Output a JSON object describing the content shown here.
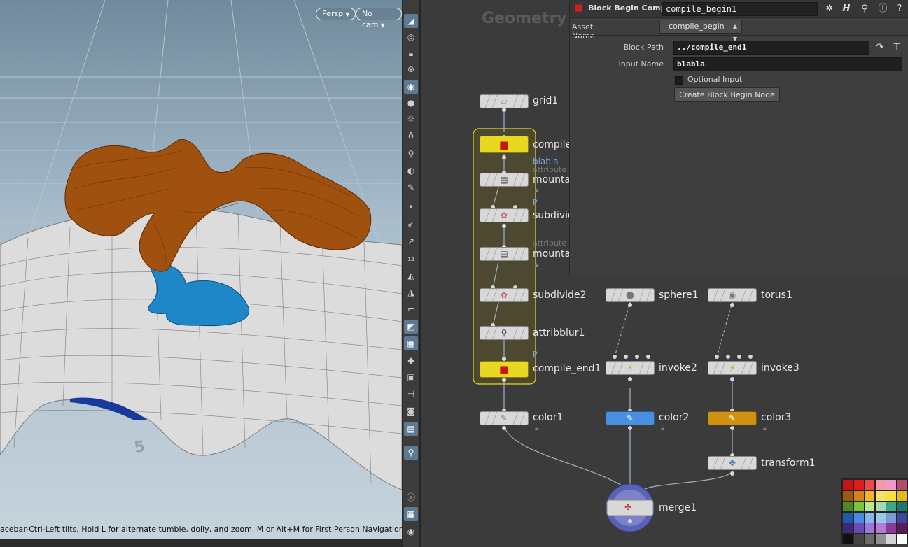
{
  "viewport": {
    "camera_mode": "Persp",
    "camera": "No cam",
    "status_text": "acebar-Ctrl-Left tilts. Hold L for alternate tumble, dolly, and zoom.    M or Alt+M for First Person Navigation.",
    "grid_number": "5"
  },
  "toolbar_icons": [
    "view-icon",
    "ghost-icon",
    "lock-icon",
    "snap-icon",
    "display-icon",
    "light-icon",
    "headlight-icon",
    "shadow-icon",
    "camera-link-icon",
    "visualizer-icon",
    "wire-icon",
    "point-icon",
    "normal-icon",
    "vector-icon",
    "point-number-icon",
    "primitive-icon",
    "prim-number-icon",
    "uv-icon",
    "shaded-icon",
    "wireframe-icon",
    "template-icon",
    "texture-icon",
    "vertex-icon",
    "background-icon",
    "pin-icon",
    "info-icon",
    "layout-icon",
    "eye-icon"
  ],
  "network": {
    "title": "Geometry",
    "nodes": [
      {
        "label": "grid1"
      },
      {
        "label": "compile_",
        "sub": "blabla"
      },
      {
        "label": "mounta",
        "sub": "attribute"
      },
      {
        "label": "subdivid"
      },
      {
        "label": "mounta",
        "sub": "attribute"
      },
      {
        "label": "subdivide2"
      },
      {
        "label": "attribblur1"
      },
      {
        "label": "compile_end1"
      },
      {
        "label": "sphere1"
      },
      {
        "label": "torus1"
      },
      {
        "label": "invoke2"
      },
      {
        "label": "invoke3"
      },
      {
        "label": "color1"
      },
      {
        "label": "color2"
      },
      {
        "label": "color3"
      },
      {
        "label": "transform1"
      },
      {
        "label": "merge1"
      }
    ],
    "p_marker": "P",
    "block_color": "#e8d820"
  },
  "params": {
    "node_type": "Block Begin Compile",
    "node_name": "compile_begin1",
    "asset_label": "Asset Name",
    "asset_value": "compile_begin",
    "block_path_label": "Block Path",
    "block_path_value": "../compile_end1",
    "input_name_label": "Input Name",
    "input_name_value": "blabla",
    "optional_label": "Optional Input",
    "create_button": "Create Block Begin Node",
    "header_icons": [
      "gear-icon",
      "help-h-icon",
      "search-icon",
      "info-icon",
      "question-icon"
    ]
  },
  "palette": {
    "colors": [
      "#c81414",
      "#e01c1c",
      "#f04848",
      "#f49aa4",
      "#f09aca",
      "#b44a6e",
      "#9a5a10",
      "#d2841a",
      "#f4b430",
      "#f6e06e",
      "#f6e23c",
      "#e6b90c",
      "#4a8a22",
      "#7cc43c",
      "#b8e890",
      "#a8d8b0",
      "#3aa88a",
      "#1a7a6a",
      "#1e5aa8",
      "#4a8ae0",
      "#8ab4ec",
      "#9ac8e8",
      "#7a9ad8",
      "#3a4a9a",
      "#3a2a7a",
      "#6a4ab4",
      "#9a7ae0",
      "#b87ad8",
      "#8a3a9a",
      "#5a1a5a",
      "#111111",
      "#444444",
      "#6a6a6a",
      "#909090",
      "#d4d4d4",
      "#ffffff"
    ]
  }
}
